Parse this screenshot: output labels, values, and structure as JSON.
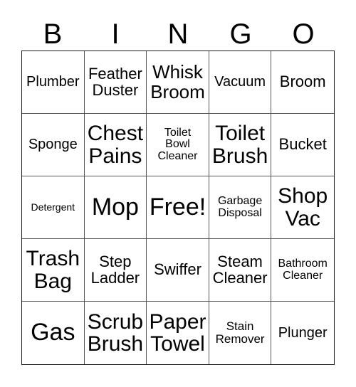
{
  "card": {
    "title": "BINGO card",
    "header_letters": [
      "B",
      "I",
      "N",
      "G",
      "O"
    ],
    "grid": {
      "columns": 5,
      "rows": 5,
      "free_space_label": "Free!",
      "free_space_position": "center",
      "cells": [
        {
          "label": "Plumber",
          "size": "m"
        },
        {
          "label": "Feather\nDuster",
          "size": "ml"
        },
        {
          "label": "Whisk\nBroom",
          "size": "l"
        },
        {
          "label": "Vacuum",
          "size": "m"
        },
        {
          "label": "Broom",
          "size": "ml"
        },
        {
          "label": "Sponge",
          "size": "m"
        },
        {
          "label": "Chest\nPains",
          "size": "xl"
        },
        {
          "label": "Toilet\nBowl\nCleaner",
          "size": "s"
        },
        {
          "label": "Toilet\nBrush",
          "size": "xl"
        },
        {
          "label": "Bucket",
          "size": "ml"
        },
        {
          "label": "Detergent",
          "size": "xs"
        },
        {
          "label": "Mop",
          "size": "xxl"
        },
        {
          "label": "Free!",
          "size": "xxl"
        },
        {
          "label": "Garbage\nDisposal",
          "size": "s"
        },
        {
          "label": "Shop\nVac",
          "size": "xl"
        },
        {
          "label": "Trash\nBag",
          "size": "xl"
        },
        {
          "label": "Step\nLadder",
          "size": "ml"
        },
        {
          "label": "Swiffer",
          "size": "ml"
        },
        {
          "label": "Steam\nCleaner",
          "size": "ml"
        },
        {
          "label": "Bathroom\nCleaner",
          "size": "s"
        },
        {
          "label": "Gas",
          "size": "xxl"
        },
        {
          "label": "Scrub\nBrush",
          "size": "xl"
        },
        {
          "label": "Paper\nTowel",
          "size": "xl"
        },
        {
          "label": "Stain\nRemover",
          "size": "sm"
        },
        {
          "label": "Plunger",
          "size": "m"
        }
      ]
    },
    "colors": {
      "background": "#ffffff",
      "text": "#000000",
      "grid_line": "#555555",
      "outer_border": "#1a1a1a"
    }
  }
}
